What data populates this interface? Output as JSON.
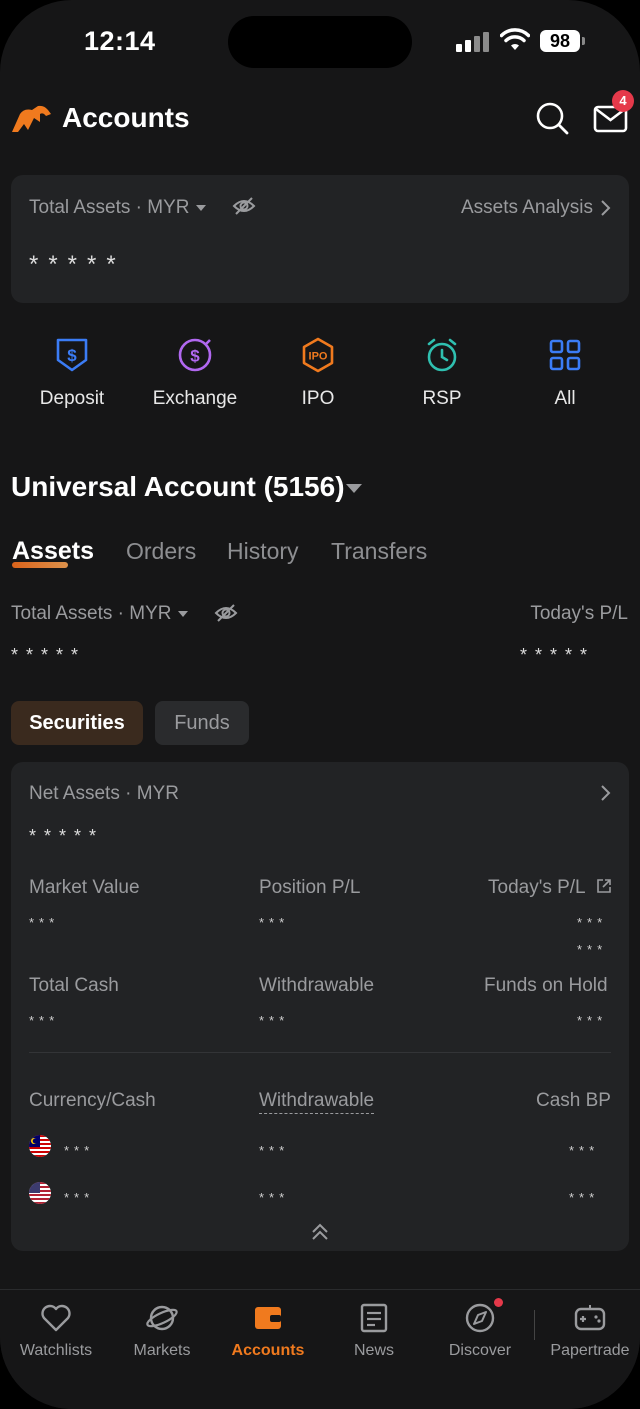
{
  "status_bar": {
    "time": "12:14",
    "battery": "98"
  },
  "header": {
    "title": "Accounts",
    "mail_badge": "4"
  },
  "summary": {
    "total_assets_label": "Total Assets · MYR",
    "analysis_link": "Assets Analysis",
    "masked_value": "*****"
  },
  "quick_actions": {
    "deposit": "Deposit",
    "exchange": "Exchange",
    "ipo": "IPO",
    "rsp": "RSP",
    "all": "All"
  },
  "account": {
    "title": "Universal Account (5156)",
    "tabs": {
      "assets": "Assets",
      "orders": "Orders",
      "history": "History",
      "transfers": "Transfers"
    },
    "total_assets_label": "Total Assets · MYR",
    "todays_pl_label": "Today's P/L",
    "total_masked": "*****",
    "pl_masked": "*****"
  },
  "segments": {
    "securities": "Securities",
    "funds": "Funds"
  },
  "net_assets": {
    "label": "Net Assets · MYR",
    "masked": "*****",
    "market_value": "Market Value",
    "position_pl": "Position P/L",
    "todays_pl": "Today's P/L",
    "total_cash": "Total Cash",
    "withdrawable": "Withdrawable",
    "funds_on_hold": "Funds on Hold",
    "dots": "***"
  },
  "cash_table": {
    "headers": {
      "currency": "Currency/Cash",
      "withdrawable": "Withdrawable",
      "cash_bp": "Cash BP"
    },
    "rows": [
      {
        "currency_flag": "malaysia-flag-icon",
        "cash": "***",
        "withdrawable": "***",
        "cash_bp": "***"
      },
      {
        "currency_flag": "usa-flag-icon",
        "cash": "***",
        "withdrawable": "***",
        "cash_bp": "***"
      }
    ]
  },
  "bottom_nav": {
    "watchlists": "Watchlists",
    "markets": "Markets",
    "accounts": "Accounts",
    "news": "News",
    "discover": "Discover",
    "papertrade": "Papertrade"
  },
  "colors": {
    "accent": "#f07a1e",
    "deposit": "#3b7cf5",
    "exchange": "#b168f0",
    "ipo": "#f07a1e",
    "rsp": "#2fc0b0",
    "all": "#3b7cf5",
    "badge": "#e5394a"
  }
}
